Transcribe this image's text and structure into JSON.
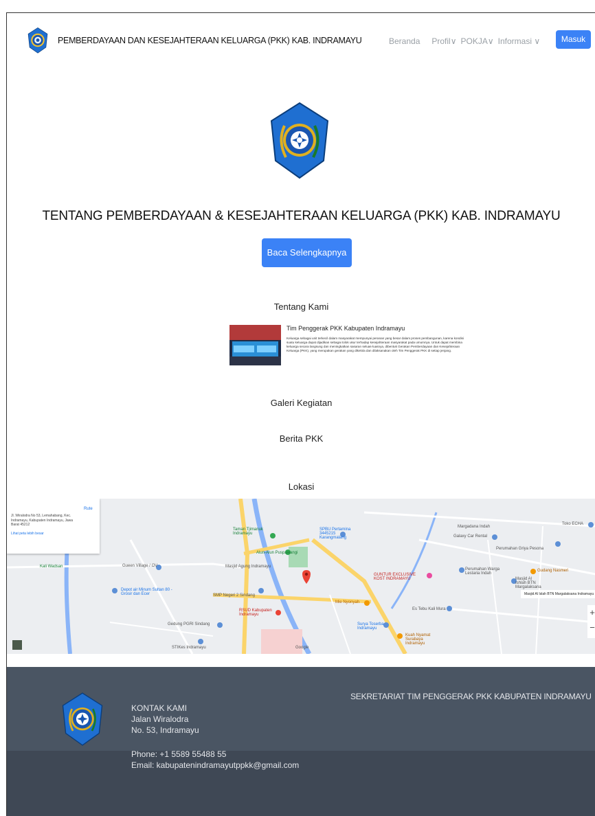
{
  "header": {
    "brand": "PEMBERDAYAAN DAN KESEJAHTERAAN KELUARGA (PKK) KAB. INDRAMAYU",
    "menu": {
      "beranda": "Beranda",
      "profil": "Profil∨",
      "pokja": "POKJA∨",
      "informasi": "Informasi ∨"
    },
    "login": "Masuk"
  },
  "hero": {
    "title": "TENTANG PEMBERDAYAAN & KESEJAHTERAAN KELUARGA (PKK) KAB. INDRAMAYU",
    "button": "Baca Selengkapnya"
  },
  "about": {
    "heading": "Tentang Kami",
    "title": "Tim Penggerak PKK Kabupaten Indramayu",
    "text": "Keluarga sebagai unit terkecil dalam masyarakat mempunyai peranan yang besar dalam proses pembangunan, karena kondisi suatu keluarga dapat dijadikan sebagai tolok ukur terhadap kesejahteraan masyarakat pada umumnya. Untuk dapat membina keluarga secara langsung dan meningkatkan sasaran seluas-luasnya, dibentuk Gerakan Pemberdayaan dan Kesejahteraan Keluarga (PKK), yang merupakan gerakan yang dikelola dan dilaksanakan oleh Tim Penggerak PKK di setiap jenjang."
  },
  "sections": {
    "gallery": "Galeri Kegiatan",
    "news": "Berita PKK",
    "location": "Lokasi"
  },
  "map": {
    "card_address": "Jl. Wiralodra No 53, Lemahabang, Kec. Indramayu, Kabupaten Indramayu, Jawa Barat 45212",
    "card_directions": "Rute",
    "card_link": "Lihat peta lebih besar",
    "labels": {
      "taman": "Taman Tjimanuk Indramayu",
      "spbu": "SPBU Pertamina 3445215 Karangmalang",
      "galaxy": "Galaxy Car Rental",
      "perumahan": "Perumahan Griya Pesona",
      "alun": "Alun-Alun Puspawangi",
      "masjid_agung": "Masjid Agung Indramayu",
      "margadana": "Margadana Indah",
      "toko": "Toko ECHA",
      "kali": "Kali Wadsan",
      "depot": "Depot air Minum Sultan 80 - Grosir dan Ecer",
      "smp": "SMP Negeri 2 Sindang",
      "guntur": "GUNTUR EXCLUSIVE KOST INDRAMAYU",
      "rsud": "RSUD Kabupaten Indramayu",
      "mie": "Mie Nyonyah",
      "gedung": "Gedung PGRI Sindang",
      "surya": "Surya Toserba Indramayu",
      "es": "Es Tebu Kali Mura",
      "kuah": "Kuah Nyamat Surabaya Indramayu",
      "perumahan_warga": "Perumahan Warga Lestaria Indah",
      "gudang": "Gudang Nasmeri",
      "masjid_btn": "Masjid Al Ishlah BTN Margalaksana",
      "tooltip": "Masjid Al Islah BTN Margalaksana Indramayu",
      "gueen": "Gueen Village / OV",
      "google": "Google",
      "sttkes": "STIKes Indramayu"
    },
    "zoom_in": "+",
    "zoom_out": "−"
  },
  "footer": {
    "contact_title": "KONTAK KAMI",
    "address1": "Jalan Wiralodra",
    "address2": "No. 53, Indramayu",
    "phone": "Phone: +1 5589 55488 55",
    "email": "Email: kabupatenindramayutppkk@gmail.com",
    "secretariat": "SEKRETARIAT TIM PENGGERAK PKK KABUPATEN INDRAMAYU"
  },
  "colors": {
    "primary": "#3b82f6",
    "footer": "#4a5563",
    "footer_bottom": "#3f4855",
    "nav_muted": "#9aa0a6"
  }
}
